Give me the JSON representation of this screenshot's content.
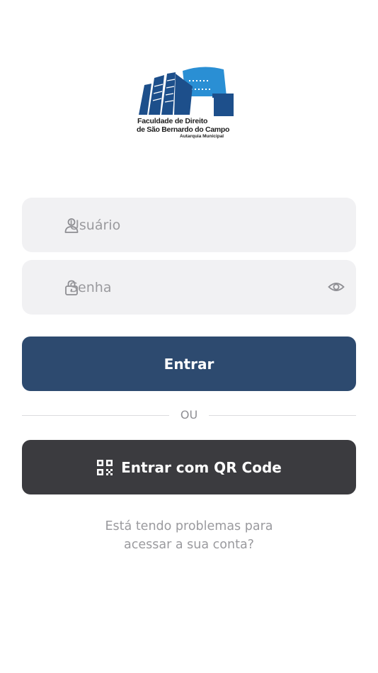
{
  "logo": {
    "line1": "Faculdade de Direito",
    "line2": "de São Bernardo do Campo",
    "line3": "Autarquia Municipal",
    "colors": {
      "dark": "#1d4f8b",
      "light": "#2a8fd4"
    }
  },
  "form": {
    "username": {
      "placeholder": "Usuário",
      "value": "",
      "icon": "user-icon"
    },
    "password": {
      "placeholder": "Senha",
      "value": "",
      "icon": "lock-icon",
      "toggle_icon": "eye-icon"
    }
  },
  "buttons": {
    "login_label": "Entrar",
    "qr_label": "Entrar com QR Code",
    "qr_icon": "qr-code-icon"
  },
  "divider_text": "OU",
  "help": {
    "line1": "Está tendo problemas para",
    "line2": "acessar a sua conta?"
  },
  "colors": {
    "primary": "#2d4a6f",
    "secondary": "#3b3b3f",
    "field_bg": "#f1f1f3",
    "muted_text": "#9a9a9e"
  }
}
